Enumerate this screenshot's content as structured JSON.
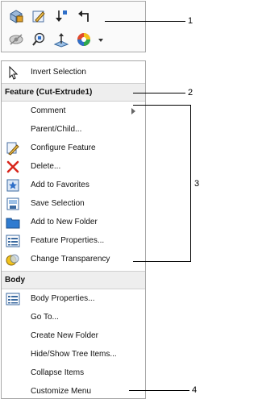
{
  "toolbar": {
    "icons": [
      "rebuild-icon",
      "edit-sketch-icon",
      "rollback-icon",
      "back-arrow-icon",
      "hide-icon",
      "zoom-to-selection-icon",
      "normal-to-icon",
      "appearance-icon",
      "dropdown-arrow-icon"
    ]
  },
  "menu": {
    "invert_selection": "Invert Selection",
    "feature_header": "Feature (Cut-Extrude1)",
    "feature_items": [
      "Comment",
      "Parent/Child...",
      "Configure Feature",
      "Delete...",
      "Add to Favorites",
      "Save Selection",
      "Add to New Folder",
      "Feature Properties...",
      "Change Transparency"
    ],
    "body_header": "Body",
    "body_items": [
      "Body Properties...",
      "Go To...",
      "Create New Folder",
      "Hide/Show Tree Items...",
      "Collapse Items",
      "Customize Menu"
    ]
  },
  "callouts": [
    "1",
    "2",
    "3",
    "4"
  ],
  "colors": {
    "delete_red": "#d8261c",
    "folder_blue": "#2f7bd0",
    "header_bg": "#eeeeee"
  }
}
